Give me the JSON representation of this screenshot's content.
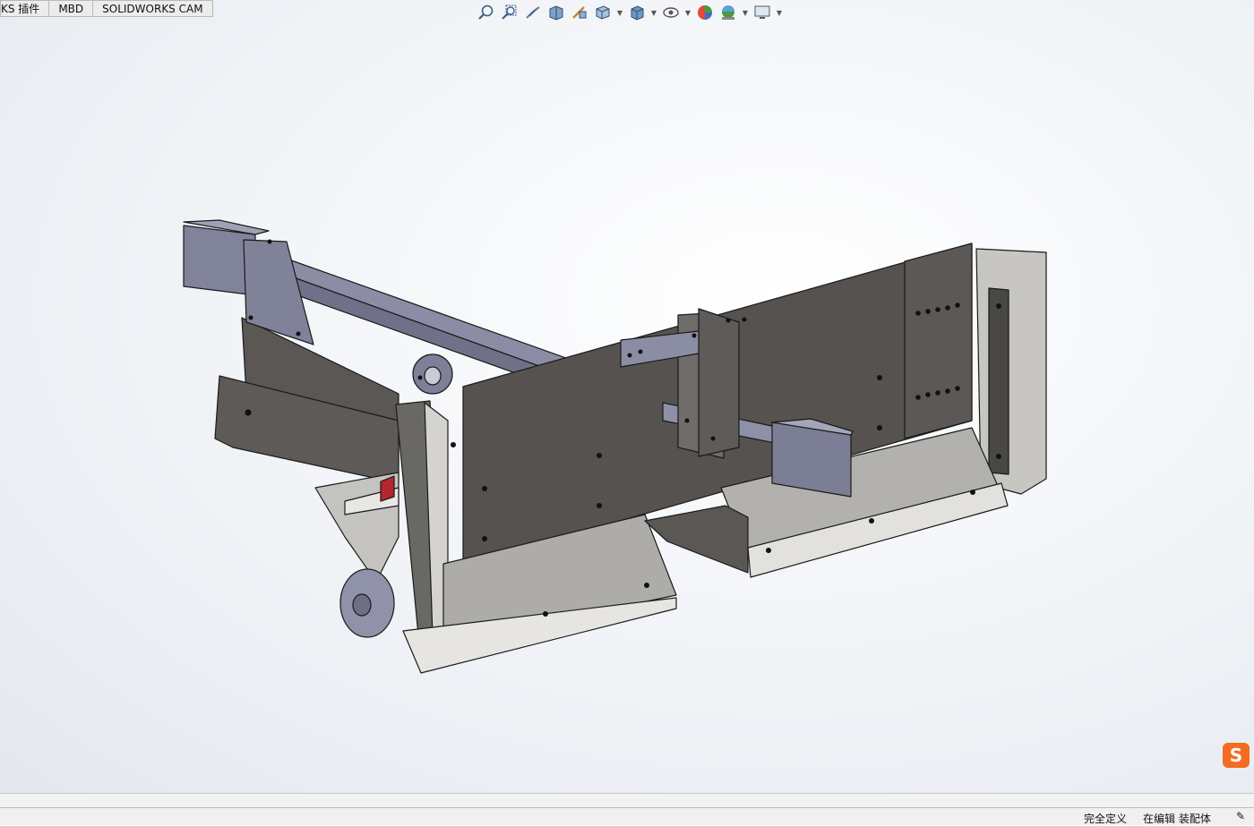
{
  "tabs": [
    {
      "label": "KS 插件"
    },
    {
      "label": "MBD"
    },
    {
      "label": "SOLIDWORKS CAM"
    }
  ],
  "view_toolbar": {
    "buttons": [
      "zoom-to-fit-icon",
      "zoom-to-area-icon",
      "previous-view-icon",
      "section-view-icon",
      "dynamic-annotation-icon",
      "view-orientation-icon",
      "display-style-icon",
      "hide-show-items-icon",
      "edit-appearance-icon",
      "apply-scene-icon",
      "view-settings-icon"
    ]
  },
  "colors": {
    "dark_plate": "#55524f",
    "light_plate": "#a8a6a2",
    "blue_steel": "#7d8097",
    "edge": "#1a1a1a",
    "sogou_badge": "#f36c21"
  },
  "sogou_badge_label": "S",
  "status": {
    "definition": "完全定义",
    "editing": "在编辑 装配体"
  }
}
